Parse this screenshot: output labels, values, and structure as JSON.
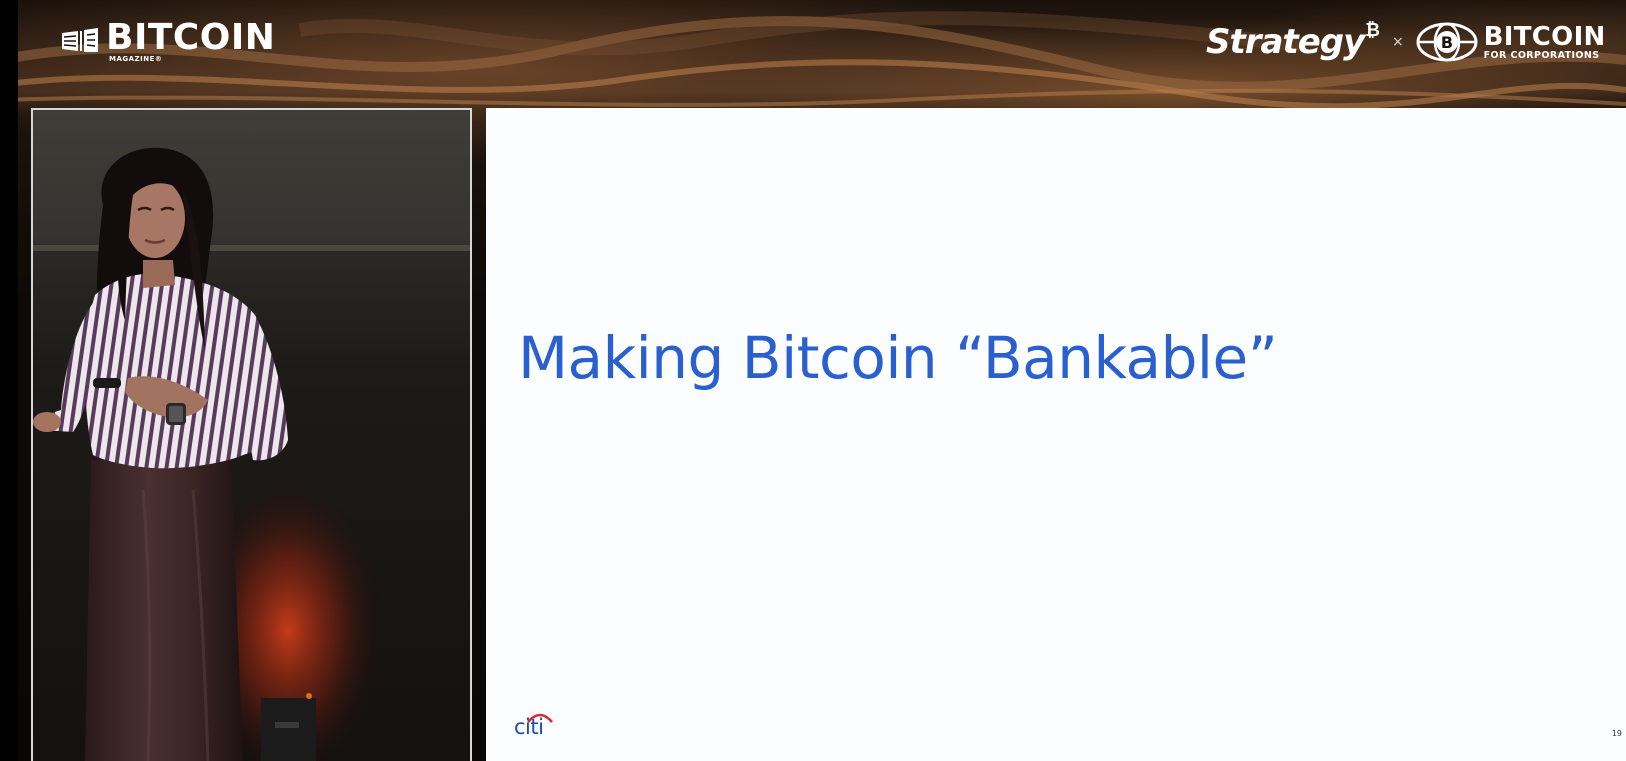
{
  "header": {
    "left_logo": {
      "name": "BITCOIN",
      "subtitle": "MAGAZINE®"
    },
    "right_logo": {
      "brand": "Strategy",
      "brand_mark": "₿",
      "separator": "×",
      "partner_name": "BITCOIN",
      "partner_subtitle": "FOR CORPORATIONS"
    }
  },
  "slide": {
    "title": "Making Bitcoin “Bankable”",
    "footer_logo": "citi",
    "page_number": "19"
  },
  "colors": {
    "slide_title": "#2a5fd0",
    "citi_blue": "#1b4fa8",
    "citi_arc": "#d8282f",
    "slide_background": "#fcfdff"
  }
}
